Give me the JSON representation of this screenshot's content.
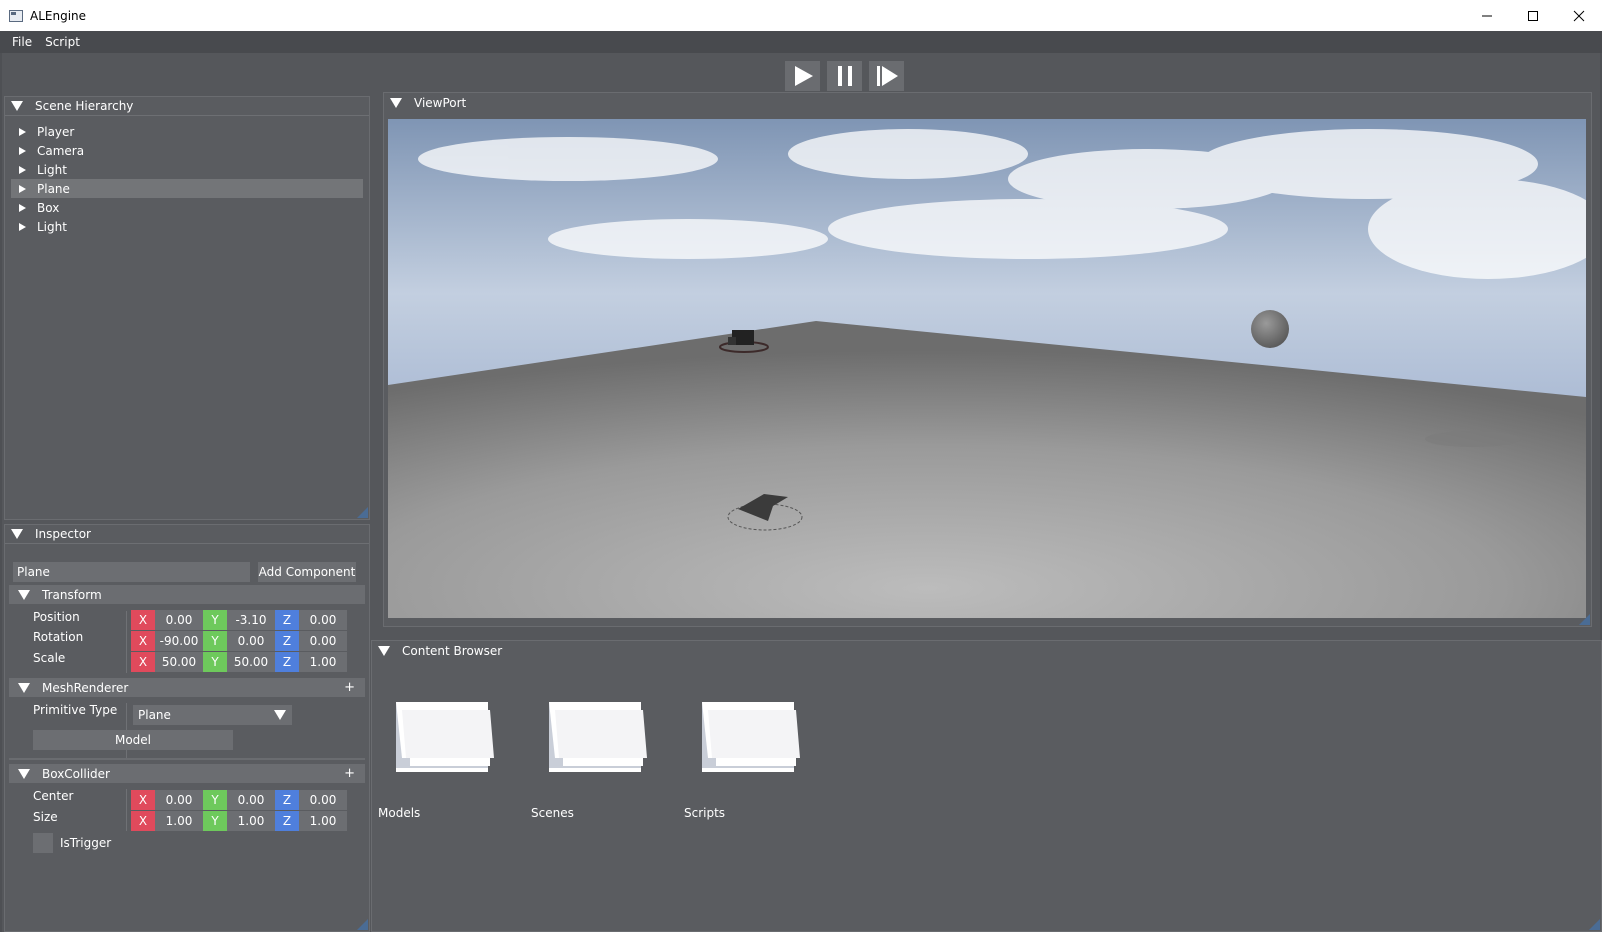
{
  "window": {
    "title": "ALEngine"
  },
  "menu": {
    "items": [
      "File",
      "Script"
    ]
  },
  "toolbar": {
    "play_icon": "play-icon",
    "pause_icon": "pause-icon",
    "step_icon": "step-icon"
  },
  "hierarchy": {
    "title": "Scene Hierarchy",
    "items": [
      {
        "label": "Player",
        "selected": false
      },
      {
        "label": "Camera",
        "selected": false
      },
      {
        "label": "Light",
        "selected": false
      },
      {
        "label": "Plane",
        "selected": true
      },
      {
        "label": "Box",
        "selected": false
      },
      {
        "label": "Light",
        "selected": false
      }
    ]
  },
  "inspector": {
    "title": "Inspector",
    "object_name": "Plane",
    "add_component_label": "Add Component",
    "transform": {
      "title": "Transform",
      "position": {
        "label": "Position",
        "x": "0.00",
        "y": "-3.10",
        "z": "0.00"
      },
      "rotation": {
        "label": "Rotation",
        "x": "-90.00",
        "y": "0.00",
        "z": "0.00"
      },
      "scale": {
        "label": "Scale",
        "x": "50.00",
        "y": "50.00",
        "z": "1.00"
      }
    },
    "mesh_renderer": {
      "title": "MeshRenderer",
      "plus": "+",
      "primitive_label": "Primitive Type",
      "primitive_value": "Plane",
      "model_label": "Model"
    },
    "box_collider": {
      "title": "BoxCollider",
      "plus": "+",
      "center": {
        "label": "Center",
        "x": "0.00",
        "y": "0.00",
        "z": "0.00"
      },
      "size": {
        "label": "Size",
        "x": "1.00",
        "y": "1.00",
        "z": "1.00"
      },
      "is_trigger_label": "IsTrigger"
    },
    "axis_labels": {
      "x": "X",
      "y": "Y",
      "z": "Z"
    }
  },
  "viewport": {
    "title": "ViewPort"
  },
  "content_browser": {
    "title": "Content Browser",
    "folders": [
      "Models",
      "Scenes",
      "Scripts"
    ]
  },
  "colors": {
    "axis_x": "#e04a5c",
    "axis_y": "#6ec95c",
    "axis_z": "#4f7fdc",
    "panel_bg": "#5a5c60",
    "grip": "#4a6c95"
  }
}
